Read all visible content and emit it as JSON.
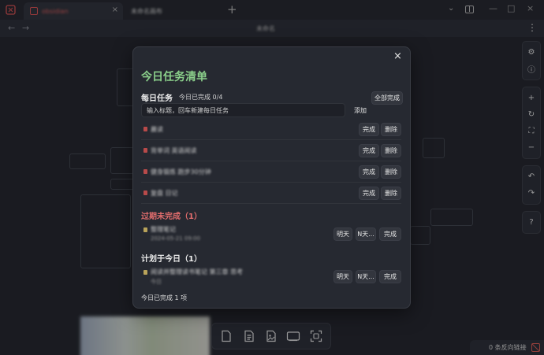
{
  "titlebar": {
    "tabs": [
      {
        "label": "obsidian",
        "close": "×"
      },
      {
        "label": "未命名画布"
      }
    ],
    "new_tab": "+",
    "chevron": "⌄",
    "window_minimize": "—",
    "window_maximize": "□",
    "window_close": "×"
  },
  "nav": {
    "back": "←",
    "forward": "→",
    "title": "未命名",
    "more": "⋮"
  },
  "right_tools": {
    "settings": "⚙",
    "info": "ⓘ",
    "zoom_in": "+",
    "reset": "↻",
    "fit": "⛶",
    "zoom_out": "−",
    "undo": "↶",
    "redo": "↷",
    "help": "?"
  },
  "footer": {
    "backlinks": "0 条反向链接"
  },
  "modal": {
    "close": "×",
    "title": "今日任务清单",
    "daily": {
      "title": "每日任务",
      "progress": "今日已完成 0/4",
      "complete_all": "全部完成",
      "input_placeholder": "输入标题，回车新建每日任务",
      "add": "添加",
      "tasks": [
        {
          "text": "晨读",
          "done": "完成",
          "delete": "删除"
        },
        {
          "text": "背单词 英语阅读",
          "done": "完成",
          "delete": "删除"
        },
        {
          "text": "健身锻炼 跑步30分钟",
          "done": "完成",
          "delete": "删除"
        },
        {
          "text": "复盘 日记",
          "done": "完成",
          "delete": "删除"
        }
      ]
    },
    "overdue": {
      "title": "过期未完成（1）",
      "tasks": [
        {
          "text": "整理笔记",
          "sub": "2024-05-21 09:00",
          "tomorrow": "明天",
          "ndays": "N天...",
          "done": "完成"
        }
      ]
    },
    "planned": {
      "title": "计划于今日（1）",
      "tasks": [
        {
          "text": "阅读并整理读书笔记 第三章 思考",
          "sub": "今日",
          "tomorrow": "明天",
          "ndays": "N天...",
          "done": "完成"
        }
      ]
    },
    "summary": "今日已完成 1 项"
  },
  "colors": {
    "accent_green": "#8bd08b",
    "overdue_red": "#e26d6d",
    "brand_red": "#c65252"
  }
}
